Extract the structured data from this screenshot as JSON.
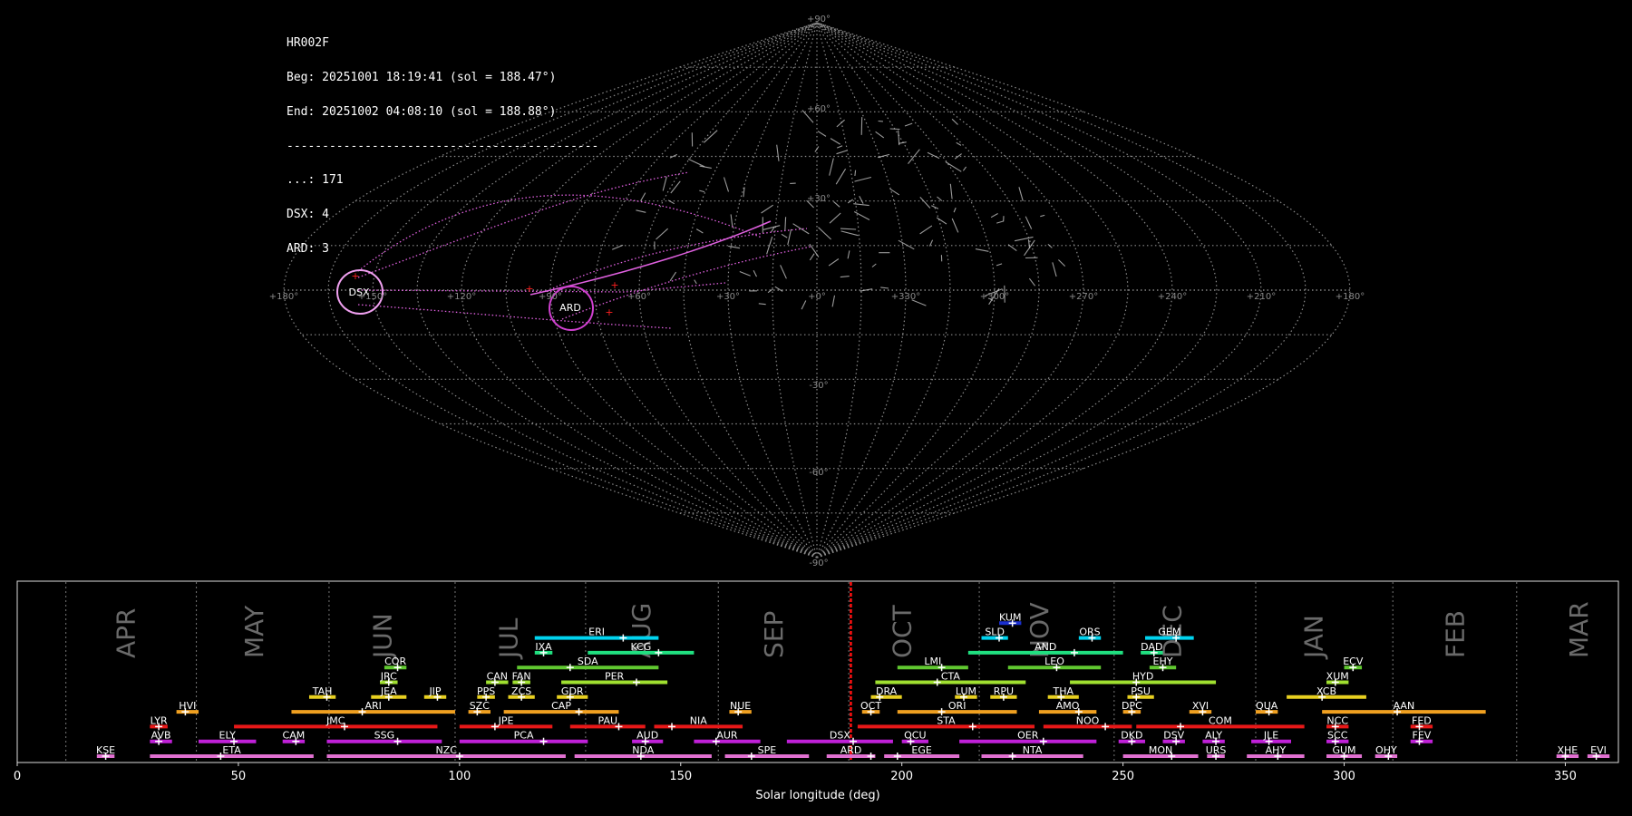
{
  "info": {
    "station": "HR002F",
    "beg": "Beg: 20251001 18:19:41 (sol = 188.47°)",
    "end": "End: 20251002 04:08:10 (sol = 188.88°)",
    "rule": "--------------------------------------------",
    "counts": [
      "...: 171",
      "DSX: 4",
      "ARD: 3"
    ]
  },
  "sky_map": {
    "lon_labels": [
      "+180°",
      "+150°",
      "+120°",
      "+90°",
      "+60°",
      "+30°",
      "+0°",
      "+330°",
      "+300°",
      "+270°",
      "+240°",
      "+210°",
      "+180°"
    ],
    "lat_labels": [
      "+90°",
      "+60°",
      "+30°",
      "-30°",
      "-60°",
      "-90°"
    ],
    "radiants": [
      "DSX",
      "ARD"
    ],
    "colors": {
      "grid": "#8a8a8a",
      "meteor": "#cfcfcf",
      "radiant": "#e060e0",
      "dsx_ring": "#f0a0f0",
      "ard_ring": "#d040d0",
      "marker": "#ff2020"
    }
  },
  "chart_data": {
    "type": "bar",
    "xlabel": "Solar longitude (deg)",
    "xlim": [
      0,
      362
    ],
    "xticks": [
      0,
      50,
      100,
      150,
      200,
      250,
      300,
      350
    ],
    "current_sol": 188.47,
    "months": [
      {
        "name": "APR",
        "boundary": 11,
        "label_at": 24.5
      },
      {
        "name": "MAY",
        "boundary": 40.5,
        "label_at": 53.5
      },
      {
        "name": "JUN",
        "boundary": 70.5,
        "label_at": 82.5
      },
      {
        "name": "JUL",
        "boundary": 99,
        "label_at": 111
      },
      {
        "name": "AUG",
        "boundary": 128.5,
        "label_at": 141
      },
      {
        "name": "SEP",
        "boundary": 158.5,
        "label_at": 171
      },
      {
        "name": "OCT",
        "boundary": 188,
        "label_at": 200
      },
      {
        "name": "NOV",
        "boundary": 217.5,
        "label_at": 231
      },
      {
        "name": "DEC",
        "boundary": 248,
        "label_at": 261
      },
      {
        "name": "JAN",
        "boundary": 280,
        "label_at": 293
      },
      {
        "name": "FEB",
        "boundary": 311,
        "label_at": 325
      },
      {
        "name": "MAR",
        "boundary": 339,
        "label_at": 353
      }
    ],
    "showers": [
      {
        "code": "KUM",
        "start": 222,
        "end": 227,
        "peak": 225,
        "row": 9,
        "color": "#1a2fd0"
      },
      {
        "code": "ERI",
        "start": 117,
        "end": 145,
        "peak": 137,
        "row": 8,
        "color": "#00d4f0"
      },
      {
        "code": "SLD",
        "start": 218,
        "end": 224,
        "peak": 222,
        "row": 8,
        "color": "#00d4f0"
      },
      {
        "code": "ORS",
        "start": 240,
        "end": 245,
        "peak": 243,
        "row": 8,
        "color": "#00d4f0"
      },
      {
        "code": "GEM",
        "start": 255,
        "end": 266,
        "peak": 262,
        "row": 8,
        "color": "#00d4f0"
      },
      {
        "code": "IXA",
        "start": 117,
        "end": 121,
        "peak": 119,
        "row": 7,
        "color": "#20e080"
      },
      {
        "code": "KCG",
        "start": 129,
        "end": 153,
        "peak": 145,
        "row": 7,
        "color": "#20e080"
      },
      {
        "code": "AND",
        "start": 215,
        "end": 250,
        "peak": 239,
        "row": 7,
        "color": "#20e080"
      },
      {
        "code": "DAD",
        "start": 254,
        "end": 259,
        "peak": 257,
        "row": 7,
        "color": "#20e080"
      },
      {
        "code": "COR",
        "start": 83,
        "end": 88,
        "peak": 86,
        "row": 6,
        "color": "#60c830"
      },
      {
        "code": "SDA",
        "start": 113,
        "end": 145,
        "peak": 125,
        "row": 6,
        "color": "#60c830"
      },
      {
        "code": "LMI",
        "start": 199,
        "end": 215,
        "peak": 209,
        "row": 6,
        "color": "#60c830"
      },
      {
        "code": "LEO",
        "start": 224,
        "end": 245,
        "peak": 235,
        "row": 6,
        "color": "#60c830"
      },
      {
        "code": "EHY",
        "start": 256,
        "end": 262,
        "peak": 259,
        "row": 6,
        "color": "#60c830"
      },
      {
        "code": "ECV",
        "start": 300,
        "end": 304,
        "peak": 302,
        "row": 6,
        "color": "#60c830"
      },
      {
        "code": "JRC",
        "start": 82,
        "end": 86,
        "peak": 84,
        "row": 5,
        "color": "#a0e030"
      },
      {
        "code": "CAN",
        "start": 106,
        "end": 111,
        "peak": 108,
        "row": 5,
        "color": "#a0e030"
      },
      {
        "code": "FAN",
        "start": 112,
        "end": 116,
        "peak": 114,
        "row": 5,
        "color": "#a0e030"
      },
      {
        "code": "PER",
        "start": 123,
        "end": 147,
        "peak": 140,
        "row": 5,
        "color": "#a0e030"
      },
      {
        "code": "CTA",
        "start": 194,
        "end": 228,
        "peak": 208,
        "row": 5,
        "color": "#a0e030"
      },
      {
        "code": "HYD",
        "start": 238,
        "end": 271,
        "peak": 253,
        "row": 5,
        "color": "#a0e030"
      },
      {
        "code": "XUM",
        "start": 296,
        "end": 301,
        "peak": 298,
        "row": 5,
        "color": "#a0e030"
      },
      {
        "code": "TAH",
        "start": 66,
        "end": 72,
        "peak": 70,
        "row": 4,
        "color": "#e8d020"
      },
      {
        "code": "JEA",
        "start": 80,
        "end": 88,
        "peak": 84,
        "row": 4,
        "color": "#e8d020"
      },
      {
        "code": "JIP",
        "start": 92,
        "end": 97,
        "peak": 95,
        "row": 4,
        "color": "#e8d020"
      },
      {
        "code": "PPS",
        "start": 104,
        "end": 108,
        "peak": 106,
        "row": 4,
        "color": "#e8d020"
      },
      {
        "code": "ZCS",
        "start": 111,
        "end": 117,
        "peak": 114,
        "row": 4,
        "color": "#e8d020"
      },
      {
        "code": "GDR",
        "start": 122,
        "end": 129,
        "peak": 125,
        "row": 4,
        "color": "#e8d020"
      },
      {
        "code": "DRA",
        "start": 193,
        "end": 200,
        "peak": 195,
        "row": 4,
        "color": "#e8d020"
      },
      {
        "code": "LUM",
        "start": 212,
        "end": 217,
        "peak": 214,
        "row": 4,
        "color": "#e8d020"
      },
      {
        "code": "RPU",
        "start": 220,
        "end": 226,
        "peak": 223,
        "row": 4,
        "color": "#e8d020"
      },
      {
        "code": "THA",
        "start": 233,
        "end": 240,
        "peak": 236,
        "row": 4,
        "color": "#e8d020"
      },
      {
        "code": "PSU",
        "start": 251,
        "end": 257,
        "peak": 253,
        "row": 4,
        "color": "#e8d020"
      },
      {
        "code": "XCB",
        "start": 287,
        "end": 305,
        "peak": 295,
        "row": 4,
        "color": "#e8d020"
      },
      {
        "code": "HVI",
        "start": 36,
        "end": 41,
        "peak": 38,
        "row": 3,
        "color": "#f0a020"
      },
      {
        "code": "ARI",
        "start": 62,
        "end": 99,
        "peak": 78,
        "row": 3,
        "color": "#f0a020"
      },
      {
        "code": "SZC",
        "start": 102,
        "end": 107,
        "peak": 104,
        "row": 3,
        "color": "#f0a020"
      },
      {
        "code": "CAP",
        "start": 110,
        "end": 136,
        "peak": 127,
        "row": 3,
        "color": "#f0a020"
      },
      {
        "code": "NUE",
        "start": 161,
        "end": 166,
        "peak": 163,
        "row": 3,
        "color": "#f0a020"
      },
      {
        "code": "OCT",
        "start": 191,
        "end": 195,
        "peak": 193,
        "row": 3,
        "color": "#f0a020"
      },
      {
        "code": "ORI",
        "start": 199,
        "end": 226,
        "peak": 209,
        "row": 3,
        "color": "#f0a020"
      },
      {
        "code": "AMO",
        "start": 231,
        "end": 244,
        "peak": 240,
        "row": 3,
        "color": "#f0a020"
      },
      {
        "code": "DPC",
        "start": 250,
        "end": 254,
        "peak": 252,
        "row": 3,
        "color": "#f0a020"
      },
      {
        "code": "XVI",
        "start": 265,
        "end": 270,
        "peak": 268,
        "row": 3,
        "color": "#f0a020"
      },
      {
        "code": "QUA",
        "start": 280,
        "end": 285,
        "peak": 283,
        "row": 3,
        "color": "#f0a020"
      },
      {
        "code": "AAN",
        "start": 295,
        "end": 332,
        "peak": 312,
        "row": 3,
        "color": "#f0a020"
      },
      {
        "code": "LYR",
        "start": 30,
        "end": 34,
        "peak": 32,
        "row": 2,
        "color": "#e81818"
      },
      {
        "code": "JMC",
        "start": 49,
        "end": 95,
        "peak": 74,
        "row": 2,
        "color": "#e81818"
      },
      {
        "code": "JPE",
        "start": 100,
        "end": 121,
        "peak": 108,
        "row": 2,
        "color": "#e81818"
      },
      {
        "code": "PAU",
        "start": 125,
        "end": 142,
        "peak": 136,
        "row": 2,
        "color": "#e81818"
      },
      {
        "code": "NIA",
        "start": 144,
        "end": 164,
        "peak": 148,
        "row": 2,
        "color": "#e81818"
      },
      {
        "code": "STA",
        "start": 190,
        "end": 230,
        "peak": 216,
        "row": 2,
        "color": "#e81818"
      },
      {
        "code": "NOO",
        "start": 232,
        "end": 252,
        "peak": 246,
        "row": 2,
        "color": "#e81818"
      },
      {
        "code": "COM",
        "start": 253,
        "end": 291,
        "peak": 263,
        "row": 2,
        "color": "#e81818"
      },
      {
        "code": "NCC",
        "start": 296,
        "end": 301,
        "peak": 298,
        "row": 2,
        "color": "#e81818"
      },
      {
        "code": "FED",
        "start": 315,
        "end": 320,
        "peak": 317,
        "row": 2,
        "color": "#e81818"
      },
      {
        "code": "AVB",
        "start": 30,
        "end": 35,
        "peak": 32,
        "row": 1,
        "color": "#c020d8"
      },
      {
        "code": "ELY",
        "start": 41,
        "end": 54,
        "peak": 49,
        "row": 1,
        "color": "#c020d8"
      },
      {
        "code": "CAM",
        "start": 60,
        "end": 65,
        "peak": 63,
        "row": 1,
        "color": "#c020d8"
      },
      {
        "code": "SSG",
        "start": 70,
        "end": 96,
        "peak": 86,
        "row": 1,
        "color": "#c020d8"
      },
      {
        "code": "PCA",
        "start": 100,
        "end": 129,
        "peak": 119,
        "row": 1,
        "color": "#c020d8"
      },
      {
        "code": "AUD",
        "start": 139,
        "end": 146,
        "peak": 142,
        "row": 1,
        "color": "#c020d8"
      },
      {
        "code": "AUR",
        "start": 153,
        "end": 168,
        "peak": 158,
        "row": 1,
        "color": "#c020d8"
      },
      {
        "code": "DSX",
        "start": 174,
        "end": 198,
        "peak": 189,
        "row": 1,
        "color": "#c020d8"
      },
      {
        "code": "OCU",
        "start": 200,
        "end": 206,
        "peak": 202,
        "row": 1,
        "color": "#c020d8"
      },
      {
        "code": "OER",
        "start": 213,
        "end": 244,
        "peak": 232,
        "row": 1,
        "color": "#c020d8"
      },
      {
        "code": "DKD",
        "start": 249,
        "end": 255,
        "peak": 252,
        "row": 1,
        "color": "#c020d8"
      },
      {
        "code": "DSV",
        "start": 259,
        "end": 264,
        "peak": 262,
        "row": 1,
        "color": "#c020d8"
      },
      {
        "code": "ALY",
        "start": 268,
        "end": 273,
        "peak": 271,
        "row": 1,
        "color": "#c020d8"
      },
      {
        "code": "JLE",
        "start": 279,
        "end": 288,
        "peak": 283,
        "row": 1,
        "color": "#c020d8"
      },
      {
        "code": "SCC",
        "start": 296,
        "end": 301,
        "peak": 298,
        "row": 1,
        "color": "#c020d8"
      },
      {
        "code": "FEV",
        "start": 315,
        "end": 320,
        "peak": 317,
        "row": 1,
        "color": "#c020d8"
      },
      {
        "code": "KSE",
        "start": 18,
        "end": 22,
        "peak": 20,
        "row": 0,
        "color": "#e070d0"
      },
      {
        "code": "ETA",
        "start": 30,
        "end": 67,
        "peak": 46,
        "row": 0,
        "color": "#e070d0"
      },
      {
        "code": "NZC",
        "start": 70,
        "end": 124,
        "peak": 100,
        "row": 0,
        "color": "#e070d0"
      },
      {
        "code": "NDA",
        "start": 126,
        "end": 157,
        "peak": 141,
        "row": 0,
        "color": "#e070d0"
      },
      {
        "code": "SPE",
        "start": 160,
        "end": 179,
        "peak": 166,
        "row": 0,
        "color": "#e070d0"
      },
      {
        "code": "ARD",
        "start": 183,
        "end": 194,
        "peak": 193,
        "row": 0,
        "color": "#e070d0"
      },
      {
        "code": "EGE",
        "start": 196,
        "end": 213,
        "peak": 199,
        "row": 0,
        "color": "#e070d0"
      },
      {
        "code": "NTA",
        "start": 218,
        "end": 241,
        "peak": 225,
        "row": 0,
        "color": "#e070d0"
      },
      {
        "code": "MON",
        "start": 250,
        "end": 267,
        "peak": 261,
        "row": 0,
        "color": "#e070d0"
      },
      {
        "code": "URS",
        "start": 269,
        "end": 273,
        "peak": 271,
        "row": 0,
        "color": "#e070d0"
      },
      {
        "code": "AHY",
        "start": 278,
        "end": 291,
        "peak": 285,
        "row": 0,
        "color": "#e070d0"
      },
      {
        "code": "GUM",
        "start": 296,
        "end": 304,
        "peak": 300,
        "row": 0,
        "color": "#e070d0"
      },
      {
        "code": "OHY",
        "start": 307,
        "end": 312,
        "peak": 310,
        "row": 0,
        "color": "#e070d0"
      },
      {
        "code": "XHE",
        "start": 348,
        "end": 353,
        "peak": 350,
        "row": 0,
        "color": "#e070d0"
      },
      {
        "code": "EVI",
        "start": 355,
        "end": 360,
        "peak": 357,
        "row": 0,
        "color": "#e070d0"
      }
    ]
  }
}
